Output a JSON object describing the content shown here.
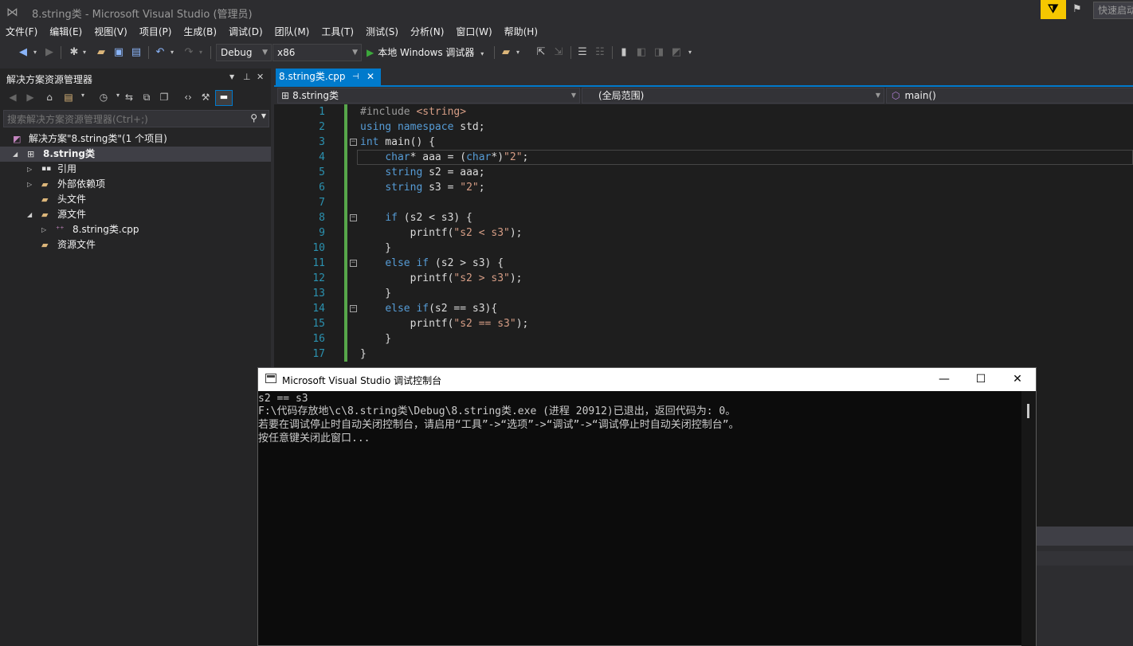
{
  "window": {
    "title": "8.string类 - Microsoft Visual Studio (管理员)",
    "quick_launch": "快速启动"
  },
  "menu": [
    "文件(F)",
    "编辑(E)",
    "视图(V)",
    "项目(P)",
    "生成(B)",
    "调试(D)",
    "团队(M)",
    "工具(T)",
    "测试(S)",
    "分析(N)",
    "窗口(W)",
    "帮助(H)"
  ],
  "toolbar": {
    "config": "Debug",
    "platform": "x86",
    "run_label": "本地 Windows 调试器"
  },
  "solution_explorer": {
    "title": "解决方案资源管理器",
    "search_placeholder": "搜索解决方案资源管理器(Ctrl+;)",
    "tree": [
      {
        "label": "解决方案\"8.string类\"(1 个项目)",
        "icon": "solution-icon"
      },
      {
        "label": "8.string类",
        "icon": "project-icon"
      },
      {
        "label": "引用",
        "icon": "references-icon"
      },
      {
        "label": "外部依赖项",
        "icon": "external-deps-icon"
      },
      {
        "label": "头文件",
        "icon": "folder-icon"
      },
      {
        "label": "源文件",
        "icon": "folder-icon"
      },
      {
        "label": "8.string类.cpp",
        "icon": "cpp-file-icon"
      },
      {
        "label": "资源文件",
        "icon": "folder-icon"
      }
    ]
  },
  "editor": {
    "tab": "8.string类.cpp",
    "nav": {
      "project": "8.string类",
      "scope": "(全局范围)",
      "member": "main()"
    },
    "line_numbers": [
      "1",
      "2",
      "3",
      "4",
      "5",
      "6",
      "7",
      "8",
      "9",
      "10",
      "11",
      "12",
      "13",
      "14",
      "15",
      "16",
      "17"
    ]
  },
  "console": {
    "title": "Microsoft Visual Studio 调试控制台",
    "lines": [
      "s2 == s3",
      "F:\\代码存放地\\c\\8.string类\\Debug\\8.string类.exe (进程 20912)已退出，返回代码为: 0。",
      "若要在调试停止时自动关闭控制台，请启用“工具”->“选项”->“调试”->“调试停止时自动关闭控制台”。",
      "按任意键关闭此窗口..."
    ]
  },
  "colors": {
    "accent": "#007acc",
    "feedback": "#f6c700",
    "keyword": "#569cd6",
    "string": "#d69d85",
    "line_number": "#2b91af",
    "change_bar": "#57a64a"
  }
}
